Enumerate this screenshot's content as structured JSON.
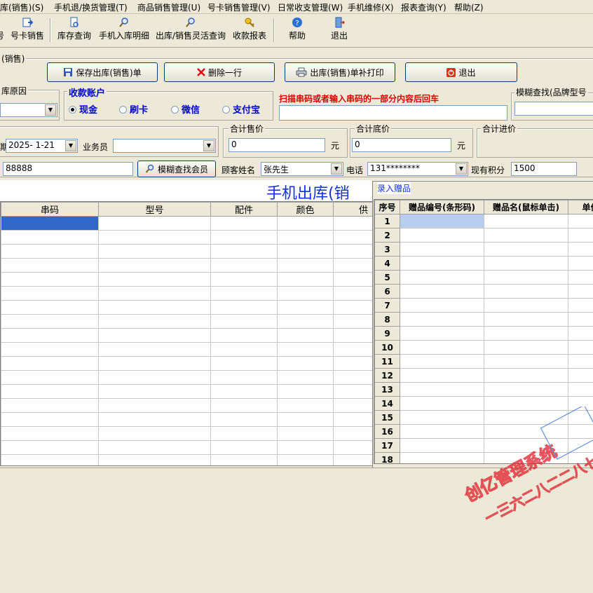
{
  "menu": [
    "库(销售)(S)",
    "手机退/换货管理(T)",
    "商品销售管理(U)",
    "号卡销售管理(V)",
    "日常收支管理(W)",
    "手机维修(X)",
    "报表查询(Y)",
    "帮助(Z)"
  ],
  "toolbar": {
    "items": [
      "号卡销售",
      "库存查询",
      "手机入库明细",
      "出库/销售灵活查询",
      "收款报表",
      "帮助",
      "退出"
    ]
  },
  "section_title": "(销售)",
  "actions": {
    "save": "保存出库(销售)单",
    "delete_row": "删除一行",
    "reprint": "出库(销售)单补打印",
    "exit": "退出"
  },
  "reason_label": "库原因",
  "account": {
    "label": "收款账户",
    "options": [
      "现金",
      "刷卡",
      "微信",
      "支付宝"
    ],
    "selected": "现金"
  },
  "scan_hint": "扫描串码或者输入串码的一部分内容后回车",
  "fuzzy_search_label": "模糊查找(品牌型号",
  "date_label": "期",
  "date_value": "2025- 1-21",
  "salesman_label": "业务员",
  "total_sale": {
    "label": "合计售价",
    "value": "0",
    "unit": "元"
  },
  "total_base": {
    "label": "合计底价",
    "value": "0",
    "unit": "元"
  },
  "total_cost": {
    "label": "合计进价"
  },
  "member": {
    "id_value": "88888",
    "search_button": "模糊查找会员",
    "name_label": "顾客姓名",
    "name_value": "张先生",
    "phone_label": "电话",
    "phone_value": "131********",
    "points_label": "现有积分",
    "points_value": "1500"
  },
  "main_title": "手机出库(销",
  "gift_popup_title": "录入赠品",
  "main_grid": {
    "columns": [
      "串码",
      "型号",
      "配件",
      "颜色",
      "供"
    ]
  },
  "gift_grid": {
    "columns": [
      "序号",
      "赠品编号(条形码)",
      "赠品名(鼠标单击)",
      "单价"
    ],
    "rows": [
      "1",
      "2",
      "3",
      "4",
      "5",
      "6",
      "7",
      "8",
      "9",
      "10",
      "11",
      "12",
      "13",
      "14",
      "15",
      "16",
      "17",
      "18"
    ]
  },
  "watermark": {
    "line1": "创亿管理系统",
    "line2": "一三六二八二二八七",
    "colors": {
      "main": "#e0202a",
      "alt": "#2a6fd8"
    }
  }
}
